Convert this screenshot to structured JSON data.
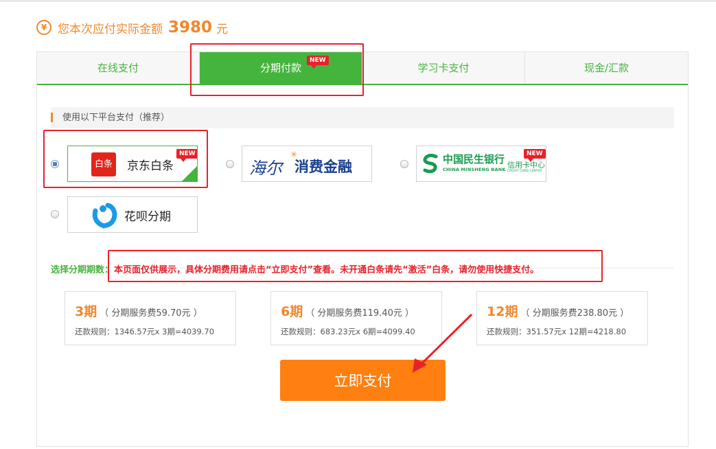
{
  "header": {
    "currency_icon": "yen-icon",
    "currency_symbol": "¥",
    "label": "您本次应付实际金额",
    "amount": "3980",
    "unit": "元"
  },
  "tabs": [
    {
      "label": "在线支付",
      "active": false
    },
    {
      "label": "分期付款",
      "active": true,
      "badge": "NEW"
    },
    {
      "label": "学习卡支付",
      "active": false
    },
    {
      "label": "现金/汇款",
      "active": false
    }
  ],
  "section": {
    "title": "使用以下平台支付（推荐）"
  },
  "platforms": [
    {
      "name": "京东白条",
      "logo_text": "白条",
      "badge": "NEW",
      "selected": true
    },
    {
      "name": "海尔消费金融",
      "logo_text_left": "海尔",
      "logo_text_right": "消费金融",
      "selected": false
    },
    {
      "name": "中国民生银行 信用卡中心",
      "logo_cn": "中国民生银行",
      "logo_en": "CHINA MINSHENG BANK",
      "logo_sub": "信用卡中心",
      "logo_sub_en": "CREDIT CARD CENTER",
      "badge": "NEW",
      "selected": false
    },
    {
      "name": "花呗分期",
      "selected": false
    }
  ],
  "installment": {
    "label": "选择分期期数：",
    "notice": "本页面仅供展示，具体分期费用请点击“立即支付”查看。未开通白条请先“激活”白条，请勿使用快捷支付。",
    "plans": [
      {
        "term": "3期",
        "fee": "（ 分期服务费59.70元 ）",
        "rule": "还款规则：1346.57元x 3期=4039.70"
      },
      {
        "term": "6期",
        "fee": "（ 分期服务费119.40元 ）",
        "rule": "还款规则：683.23元x 6期=4099.40"
      },
      {
        "term": "12期",
        "fee": "（ 分期服务费238.80元 ）",
        "rule": "还款规则：351.57元x 12期=4218.80"
      }
    ]
  },
  "pay_button": {
    "label": "立即支付",
    "color": "#ff7f11"
  },
  "colors": {
    "accent_green": "#45b43c",
    "accent_orange": "#f0882c",
    "highlight_red": "#e8212a"
  }
}
